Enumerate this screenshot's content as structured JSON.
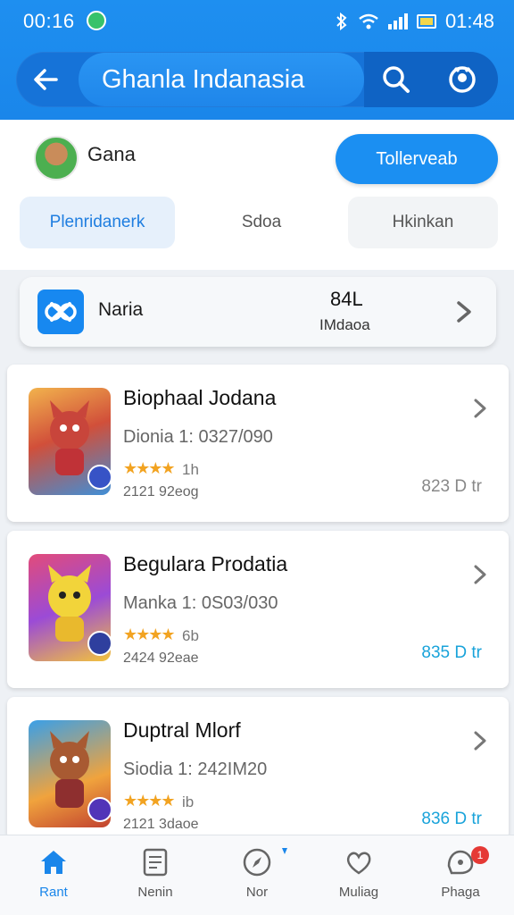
{
  "status_bar": {
    "time": "00:16",
    "clock_right": "01:48"
  },
  "header": {
    "title": "Ghanla Indanasia",
    "back_icon": "arrow-left-icon",
    "search_icon": "search-icon",
    "profile_icon": "profile-icon"
  },
  "profile": {
    "name": "Gana",
    "action_label": "Tollerveab"
  },
  "tabs": [
    {
      "label": "Plenridanerk",
      "active": true
    },
    {
      "label": "Sdoa"
    },
    {
      "label": "Hkinkan"
    }
  ],
  "summary": {
    "label": "Naria",
    "value": "84L",
    "unit": "IMdaoa"
  },
  "apps": [
    {
      "name": "Biophaal Jodana",
      "meta": "Dionia 1: 0327/090",
      "stars": "★★★★",
      "rating_extra": "1h",
      "size": "2121 92eog",
      "price": "823 D tr",
      "price_color": "#888888"
    },
    {
      "name": "Begulara Prodatia",
      "meta": "Manka 1: 0S03/030",
      "stars": "★★★★",
      "rating_extra": "6b",
      "size": "2424 92eae",
      "price": "835 D tr",
      "price_color": "#19a3da"
    },
    {
      "name": "Duptral Mlorf",
      "meta": "Siodia 1: 242IM20",
      "stars": "★★★★",
      "rating_extra": "ib",
      "size": "2121 3daoe",
      "price": "836 D tr",
      "price_color": "#19a3da"
    }
  ],
  "bottom_nav": [
    {
      "label": "Rant",
      "icon": "home-icon",
      "active": true
    },
    {
      "label": "Nenin",
      "icon": "document-icon"
    },
    {
      "label": "Nor",
      "icon": "compass-icon"
    },
    {
      "label": "Muliag",
      "icon": "heart-chat-icon"
    },
    {
      "label": "Phaga",
      "icon": "chat-icon",
      "badge": "1"
    }
  ],
  "colors": {
    "primary": "#1a86ea",
    "accent_blue": "#19a3da",
    "star": "#f2a321"
  }
}
